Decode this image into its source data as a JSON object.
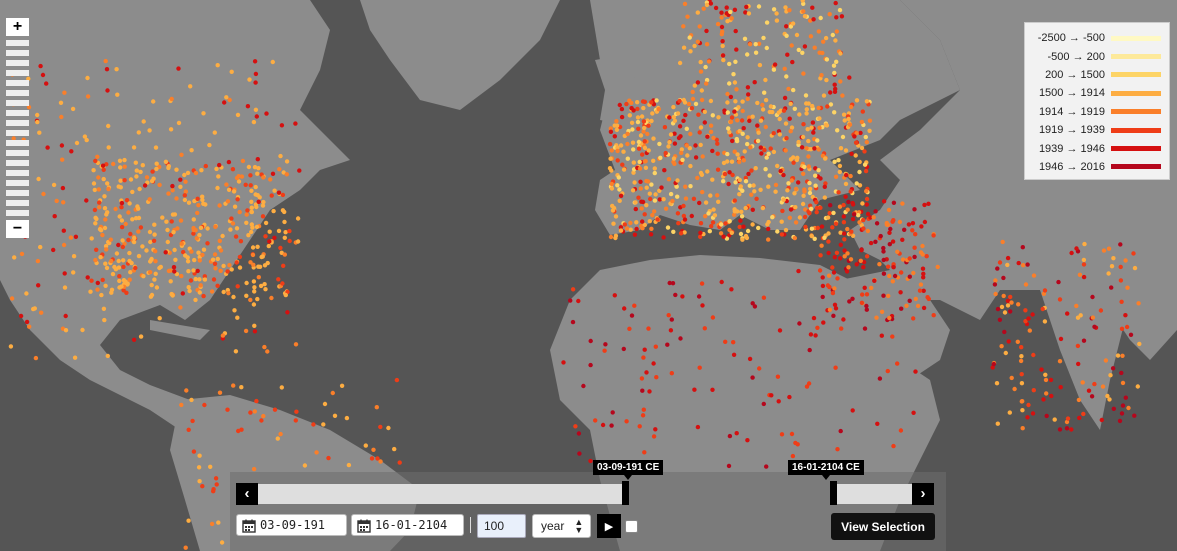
{
  "map": {
    "ocean_color": "#555555",
    "land_color": "#8c8c8c"
  },
  "zoom": {
    "zoom_in_label": "+",
    "zoom_out_label": "−"
  },
  "legend": {
    "items": [
      {
        "label": "-2500 → -500",
        "color": "#fff9c4"
      },
      {
        "label": "-500 → 200",
        "color": "#fde99a"
      },
      {
        "label": "200 → 1500",
        "color": "#fdd466"
      },
      {
        "label": "1500 → 1914",
        "color": "#fdad42"
      },
      {
        "label": "1914 → 1919",
        "color": "#fa7f2a"
      },
      {
        "label": "1919 → 1939",
        "color": "#ef3d17"
      },
      {
        "label": "1939 → 1946",
        "color": "#d51010"
      },
      {
        "label": "1946 → 2016",
        "color": "#b5071d"
      }
    ]
  },
  "timeline": {
    "start_label": "03-09-191 CE",
    "end_label": "16-01-2104 CE",
    "prev_icon": "chevron-left-icon",
    "next_icon": "chevron-right-icon",
    "start_value": "03-09-191",
    "end_value": "16-01-2104",
    "step": "100",
    "unit": "year",
    "play_icon": "play-icon",
    "view_button": "View Selection"
  }
}
